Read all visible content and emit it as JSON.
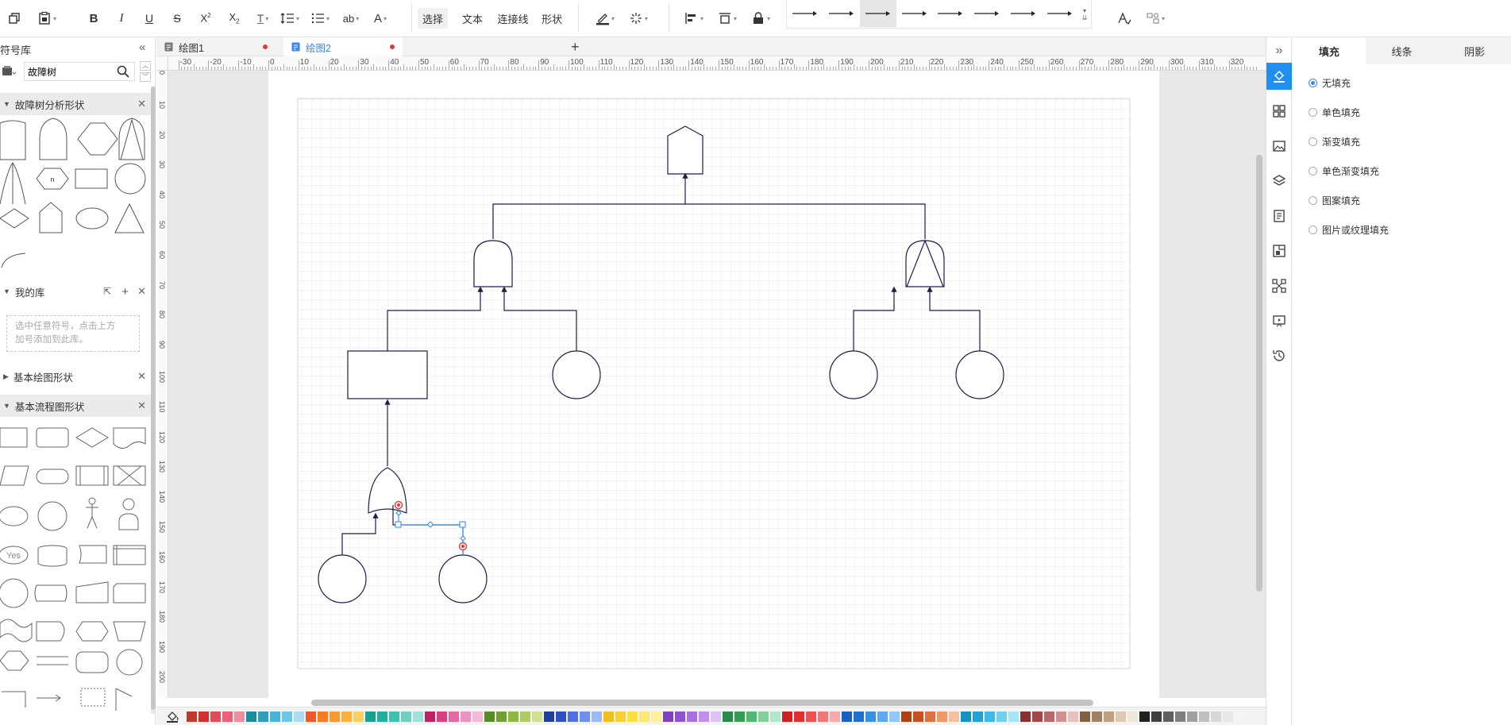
{
  "toolbar": {
    "mode_buttons": [
      "选择",
      "文本",
      "连接线",
      "形状"
    ],
    "active_mode": "选择"
  },
  "library": {
    "title": "符号库",
    "search_value": "故障树",
    "sections": {
      "fault_tree": "故障树分析形状",
      "my_library": "我的库",
      "my_library_hint_line1": "选中任意符号，点击上方",
      "my_library_hint_line2": "加号添加到此库。",
      "basic_drawing": "基本绘图形状",
      "basic_flowchart": "基本流程图形状"
    },
    "fault_tree_n_label": "n",
    "flow_yes_label": "Yes"
  },
  "tabs": [
    {
      "label": "绘图1",
      "unsaved": true,
      "active": false
    },
    {
      "label": "绘图2",
      "unsaved": true,
      "active": true
    }
  ],
  "ruler": {
    "top_labels": [
      "-30",
      "-20",
      "-10",
      "0",
      "10",
      "20",
      "30",
      "40",
      "50",
      "60",
      "70",
      "80",
      "90",
      "100",
      "110",
      "120",
      "130",
      "140",
      "150",
      "160",
      "170",
      "180",
      "190",
      "200",
      "210",
      "220",
      "230",
      "240",
      "250",
      "260",
      "270",
      "280",
      "290",
      "300",
      "310",
      "320"
    ],
    "left_labels": [
      "0",
      "10",
      "20",
      "30",
      "40",
      "50",
      "60",
      "70",
      "80",
      "90",
      "100",
      "110",
      "120",
      "130",
      "140",
      "150",
      "160",
      "170",
      "180",
      "190",
      "200"
    ]
  },
  "properties": {
    "tabs": [
      "填充",
      "线条",
      "阴影"
    ],
    "active_tab": "填充",
    "fill_options": [
      "无填充",
      "单色填充",
      "渐变填充",
      "单色渐变填充",
      "图案填充",
      "图片或纹理填充"
    ],
    "selected_fill": "无填充"
  },
  "colors": {
    "accent": "#1f8ff0",
    "shape_stroke": "#1a1f4a",
    "selection": "#1f8ff0",
    "handle_red": "#e53935",
    "palette": [
      "#c0392b",
      "#d0312d",
      "#e04a5a",
      "#e8607a",
      "#f08ca0",
      "#1e8a9a",
      "#2aa0c0",
      "#4ab4d8",
      "#6cc6e8",
      "#a8dcf0",
      "#f05a28",
      "#f57c20",
      "#f89a30",
      "#fbb040",
      "#fcd060",
      "#18a090",
      "#20b0a0",
      "#40c0b0",
      "#70d0c0",
      "#a0e0d8",
      "#c02060",
      "#d84080",
      "#e868a0",
      "#f090c0",
      "#f8b8d8",
      "#5a8a2a",
      "#70a030",
      "#90b840",
      "#b0cc60",
      "#d0e090",
      "#2040a0",
      "#3050c0",
      "#5070e0",
      "#7090f0",
      "#a0b8f8",
      "#f0c020",
      "#f8d030",
      "#fce040",
      "#fde870",
      "#fef0a0",
      "#8040c0",
      "#9050d0",
      "#a870e0",
      "#c090f0",
      "#e0c0f8",
      "#2a8a4a",
      "#30a050",
      "#50b870",
      "#80d098",
      "#b0e8c8",
      "#d02020",
      "#e03030",
      "#f05050",
      "#f07878",
      "#f8a8a8",
      "#1a60c0",
      "#2070d0",
      "#3890e0",
      "#60a8f0",
      "#90c8f8",
      "#b04010",
      "#c85020",
      "#e07040",
      "#f09868",
      "#f8c0a0",
      "#1890c0",
      "#20a0d8",
      "#40b8e8",
      "#70d0f0",
      "#a8e4f8",
      "#8a3030",
      "#a04848",
      "#b86868",
      "#d09090",
      "#e8c0c0",
      "#806040",
      "#a08060",
      "#c0a080",
      "#e0c8b0",
      "#f0e8d8",
      "#202020",
      "#404040",
      "#606060",
      "#808080",
      "#a0a0a0",
      "#c0c0c0",
      "#d8d8d8",
      "#e8e8e8",
      "#f4f4f4"
    ]
  },
  "icons": {
    "toolbar": [
      "copy-format-icon",
      "paste-icon",
      "bold-icon",
      "italic-icon",
      "underline-icon",
      "strikethrough-icon",
      "superscript-icon",
      "subscript-icon",
      "text-format-icon",
      "line-spacing-icon",
      "list-icon",
      "text-case-icon",
      "font-color-icon",
      "line-color-icon",
      "effects-icon",
      "align-icon",
      "distribute-icon",
      "lock-icon",
      "style-icon",
      "format-brush-icon"
    ],
    "rightbar": [
      "collapse-icon",
      "fill-icon",
      "grid-icon",
      "image-icon",
      "layers-icon",
      "page-icon",
      "page-setup-icon",
      "connector-icon",
      "presentation-icon",
      "history-icon"
    ]
  }
}
